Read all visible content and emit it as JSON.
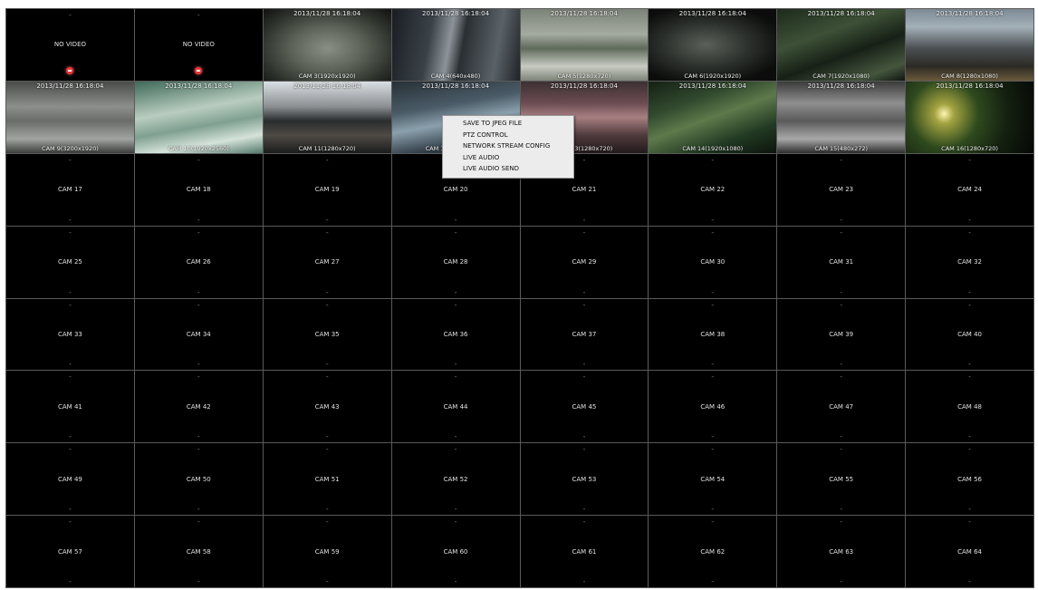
{
  "cells": [
    {
      "kind": "novideo",
      "label": "NO VIDEO",
      "top": "-",
      "rec": true
    },
    {
      "kind": "novideo",
      "label": "NO VIDEO",
      "top": "-",
      "rec": true
    },
    {
      "kind": "video",
      "ts": "2013/11/28  16:18:04",
      "caption": "CAM 3(1920x1920)",
      "scene": "shop-fisheye"
    },
    {
      "kind": "video",
      "ts": "2013/11/28  16:18:04",
      "caption": "CAM 4(640x480)",
      "scene": "window"
    },
    {
      "kind": "video",
      "ts": "2013/11/28  16:18:04",
      "caption": "CAM 5(1280x720)",
      "scene": "office"
    },
    {
      "kind": "video",
      "ts": "2013/11/28  16:18:04",
      "caption": "CAM 6(1920x1920)",
      "scene": "dark-fisheye"
    },
    {
      "kind": "video",
      "ts": "2013/11/28  16:18:04",
      "caption": "CAM 7(1920x1080)",
      "scene": "plants"
    },
    {
      "kind": "video",
      "ts": "2013/11/28  16:18:04",
      "caption": "CAM 8(1280x1080)",
      "scene": "city-night"
    },
    {
      "kind": "video",
      "ts": "2013/11/28  16:18:04",
      "caption": "CAM 9(3200x1920)",
      "scene": "warehouse"
    },
    {
      "kind": "video",
      "ts": "2013/11/28  16:18:04",
      "caption": "CAM 10(1920x2560)",
      "scene": "lab"
    },
    {
      "kind": "video",
      "ts": "2013/11/28  16:18:04",
      "caption": "CAM 11(1280x720)",
      "scene": "store"
    },
    {
      "kind": "video",
      "ts": "2013/11/28  16:18:04",
      "caption": "CAM 12(1920x1080)",
      "scene": "lobby",
      "selected": true
    },
    {
      "kind": "video",
      "ts": "2013/11/28  16:18:04",
      "caption": "CAM 13(1280x720)",
      "scene": "street"
    },
    {
      "kind": "video",
      "ts": "2013/11/28  16:18:04",
      "caption": "CAM 14(1920x1080)",
      "scene": "greenhouse"
    },
    {
      "kind": "video",
      "ts": "2013/11/28  16:18:04",
      "caption": "CAM 15(480x272)",
      "scene": "room"
    },
    {
      "kind": "video",
      "ts": "2013/11/28  16:18:04",
      "caption": "CAM 16(1280x720)",
      "scene": "night-lights"
    },
    {
      "kind": "cam",
      "label": "CAM 17"
    },
    {
      "kind": "cam",
      "label": "CAM 18"
    },
    {
      "kind": "cam",
      "label": "CAM 19"
    },
    {
      "kind": "cam",
      "label": "CAM 20"
    },
    {
      "kind": "cam",
      "label": "CAM 21"
    },
    {
      "kind": "cam",
      "label": "CAM 22"
    },
    {
      "kind": "cam",
      "label": "CAM 23"
    },
    {
      "kind": "cam",
      "label": "CAM 24"
    },
    {
      "kind": "cam",
      "label": "CAM 25"
    },
    {
      "kind": "cam",
      "label": "CAM 26"
    },
    {
      "kind": "cam",
      "label": "CAM 27"
    },
    {
      "kind": "cam",
      "label": "CAM 28"
    },
    {
      "kind": "cam",
      "label": "CAM 29"
    },
    {
      "kind": "cam",
      "label": "CAM 30"
    },
    {
      "kind": "cam",
      "label": "CAM 31"
    },
    {
      "kind": "cam",
      "label": "CAM 32"
    },
    {
      "kind": "cam",
      "label": "CAM 33"
    },
    {
      "kind": "cam",
      "label": "CAM 34"
    },
    {
      "kind": "cam",
      "label": "CAM 35"
    },
    {
      "kind": "cam",
      "label": "CAM 36"
    },
    {
      "kind": "cam",
      "label": "CAM 37"
    },
    {
      "kind": "cam",
      "label": "CAM 38"
    },
    {
      "kind": "cam",
      "label": "CAM 39"
    },
    {
      "kind": "cam",
      "label": "CAM 40"
    },
    {
      "kind": "cam",
      "label": "CAM 41"
    },
    {
      "kind": "cam",
      "label": "CAM 42"
    },
    {
      "kind": "cam",
      "label": "CAM 43"
    },
    {
      "kind": "cam",
      "label": "CAM 44"
    },
    {
      "kind": "cam",
      "label": "CAM 45"
    },
    {
      "kind": "cam",
      "label": "CAM 46"
    },
    {
      "kind": "cam",
      "label": "CAM 47"
    },
    {
      "kind": "cam",
      "label": "CAM 48"
    },
    {
      "kind": "cam",
      "label": "CAM 49"
    },
    {
      "kind": "cam",
      "label": "CAM 50"
    },
    {
      "kind": "cam",
      "label": "CAM 51"
    },
    {
      "kind": "cam",
      "label": "CAM 52"
    },
    {
      "kind": "cam",
      "label": "CAM 53"
    },
    {
      "kind": "cam",
      "label": "CAM 54"
    },
    {
      "kind": "cam",
      "label": "CAM 55"
    },
    {
      "kind": "cam",
      "label": "CAM 56"
    },
    {
      "kind": "cam",
      "label": "CAM 57"
    },
    {
      "kind": "cam",
      "label": "CAM 58"
    },
    {
      "kind": "cam",
      "label": "CAM 59"
    },
    {
      "kind": "cam",
      "label": "CAM 60"
    },
    {
      "kind": "cam",
      "label": "CAM 61"
    },
    {
      "kind": "cam",
      "label": "CAM 62"
    },
    {
      "kind": "cam",
      "label": "CAM 63"
    },
    {
      "kind": "cam",
      "label": "CAM 64"
    }
  ],
  "empty_cell_marker": "-",
  "context_menu": {
    "items": [
      "SAVE TO JPEG FILE",
      "PTZ CONTROL",
      "NETWORK STREAM CONFIG",
      "LIVE AUDIO",
      "LIVE AUDIO SEND"
    ]
  },
  "colors": {
    "grid_line": "#5a5a5a",
    "selected_outline": "#c9c94a",
    "rec_indicator": "#e33333"
  }
}
